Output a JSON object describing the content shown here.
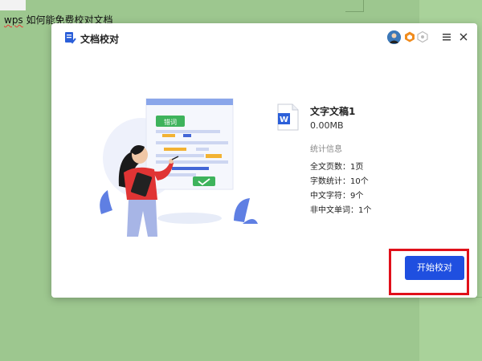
{
  "document": {
    "text_prefix": "wps",
    "text_rest": " 如何能免费校对文档"
  },
  "dialog": {
    "title": "文档校对",
    "file": {
      "name": "文字文稿1",
      "size": "0.00MB"
    },
    "stats": {
      "heading": "统计信息",
      "rows": [
        {
          "label": "全文页数：",
          "value": "1页"
        },
        {
          "label": "字数统计：",
          "value": "10个"
        },
        {
          "label": "中文字符：",
          "value": "9个"
        },
        {
          "label": "非中文单词：",
          "value": "1个"
        }
      ]
    },
    "illustration_tag": "错词",
    "start_button": "开始校对"
  },
  "colors": {
    "background": "#a8cf99",
    "primary": "#1f4fe0",
    "highlight": "#e0101a",
    "wps_blue": "#2b5fd9"
  }
}
